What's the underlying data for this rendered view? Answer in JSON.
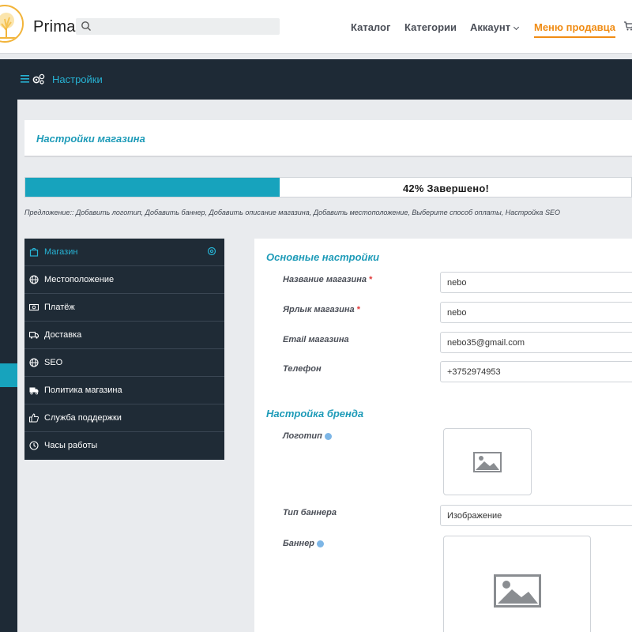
{
  "header": {
    "brand": "Prima",
    "search": {
      "value": "",
      "placeholder": ""
    },
    "nav": {
      "catalog": "Каталог",
      "categories": "Категории",
      "account": "Аккаунт",
      "seller_menu": "Меню продавца"
    },
    "colors": {
      "accent": "#f08c14"
    }
  },
  "toolbar": {
    "title": "Настройки",
    "colors": {
      "background": "#1e2a36",
      "title": "#27b3d4"
    }
  },
  "page": {
    "title": "Настройки магазина"
  },
  "progress": {
    "percent": 42,
    "label": "42% Завершено!",
    "colors": {
      "fill": "#17a3bd"
    }
  },
  "suggestion": "Предложение:: Добавить логотип, Добавить баннер, Добавить описание магазина, Добавить местоположение, Выберите способ оплаты, Настройка SEO",
  "settings_menu": {
    "items": [
      {
        "label": "Магазин",
        "icon": "shopping-bag-icon",
        "active": true
      },
      {
        "label": "Местоположение",
        "icon": "globe-icon",
        "active": false
      },
      {
        "label": "Платёж",
        "icon": "money-icon",
        "active": false
      },
      {
        "label": "Доставка",
        "icon": "truck-icon",
        "active": false
      },
      {
        "label": "SEO",
        "icon": "globe-icon",
        "active": false
      },
      {
        "label": "Политика магазина",
        "icon": "shipping-truck-icon",
        "active": false
      },
      {
        "label": "Служба поддержки",
        "icon": "thumbs-up-icon",
        "active": false
      },
      {
        "label": "Часы работы",
        "icon": "clock-icon",
        "active": false
      }
    ]
  },
  "form": {
    "basic": {
      "title": "Основные настройки",
      "store_name": {
        "label": "Название магазина",
        "required": "*",
        "value": "nebo"
      },
      "store_slug": {
        "label": "Ярлык магазина",
        "required": "*",
        "value": "nebo"
      },
      "store_email": {
        "label": "Email магазина",
        "value": "nebo35@gmail.com"
      },
      "phone": {
        "label": "Телефон",
        "value": "+3752974953"
      }
    },
    "brand": {
      "title": "Настройка бренда",
      "logo": {
        "label": "Логотип"
      },
      "banner_type": {
        "label": "Тип баннера",
        "value": "Изображение"
      },
      "banner": {
        "label": "Баннер"
      }
    }
  }
}
